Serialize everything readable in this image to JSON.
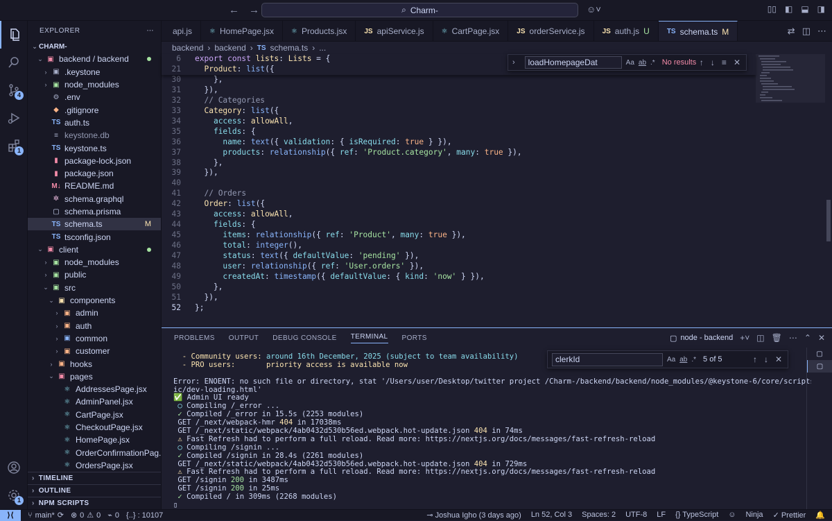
{
  "titlebar": {
    "search": "Charm-"
  },
  "activity": {
    "scm_badge": "4",
    "ext_badge": "1",
    "acct_badge": "1"
  },
  "sidebar": {
    "title": "EXPLORER",
    "root": "CHARM-",
    "items": [
      {
        "label": "backend / backend",
        "depth": 1,
        "kind": "folder-open",
        "icon": "▣",
        "icon_color": "#f38ba8",
        "status": "dot",
        "status_color": "#a6e3a1"
      },
      {
        "label": ".keystone",
        "depth": 2,
        "kind": "folder",
        "icon": "▣",
        "icon_color": "#a6adc8"
      },
      {
        "label": "node_modules",
        "depth": 2,
        "kind": "folder",
        "icon": "▣",
        "icon_color": "#a6e3a1"
      },
      {
        "label": ".env",
        "depth": 2,
        "kind": "file",
        "icon": "⚙",
        "icon_color": "#a6adc8"
      },
      {
        "label": ".gitignore",
        "depth": 2,
        "kind": "file",
        "icon": "◆",
        "icon_color": "#fab387"
      },
      {
        "label": "auth.ts",
        "depth": 2,
        "kind": "file",
        "icon": "TS",
        "icon_color": "#89b4fa"
      },
      {
        "label": "keystone.db",
        "depth": 2,
        "kind": "file",
        "icon": "≡",
        "icon_color": "#a6adc8",
        "muted": true
      },
      {
        "label": "keystone.ts",
        "depth": 2,
        "kind": "file",
        "icon": "TS",
        "icon_color": "#89b4fa"
      },
      {
        "label": "package-lock.json",
        "depth": 2,
        "kind": "file",
        "icon": "▮",
        "icon_color": "#f38ba8"
      },
      {
        "label": "package.json",
        "depth": 2,
        "kind": "file",
        "icon": "▮",
        "icon_color": "#f38ba8"
      },
      {
        "label": "README.md",
        "depth": 2,
        "kind": "file",
        "icon": "M↓",
        "icon_color": "#f38ba8"
      },
      {
        "label": "schema.graphql",
        "depth": 2,
        "kind": "file",
        "icon": "✲",
        "icon_color": "#f5c2e7"
      },
      {
        "label": "schema.prisma",
        "depth": 2,
        "kind": "file",
        "icon": "▢",
        "icon_color": "#cdd6f4"
      },
      {
        "label": "schema.ts",
        "depth": 2,
        "kind": "file",
        "icon": "TS",
        "icon_color": "#89b4fa",
        "selected": true,
        "status": "M",
        "status_color": "#f9e2af"
      },
      {
        "label": "tsconfig.json",
        "depth": 2,
        "kind": "file",
        "icon": "TS",
        "icon_color": "#89b4fa"
      },
      {
        "label": "client",
        "depth": 1,
        "kind": "folder-open",
        "icon": "▣",
        "icon_color": "#f38ba8",
        "status": "dot",
        "status_color": "#a6e3a1"
      },
      {
        "label": "node_modules",
        "depth": 2,
        "kind": "folder",
        "icon": "▣",
        "icon_color": "#a6e3a1"
      },
      {
        "label": "public",
        "depth": 2,
        "kind": "folder",
        "icon": "▣",
        "icon_color": "#a6e3a1"
      },
      {
        "label": "src",
        "depth": 2,
        "kind": "folder-open",
        "icon": "▣",
        "icon_color": "#a6e3a1"
      },
      {
        "label": "components",
        "depth": 3,
        "kind": "folder-open",
        "icon": "▣",
        "icon_color": "#f9e2af"
      },
      {
        "label": "admin",
        "depth": 4,
        "kind": "folder",
        "icon": "▣",
        "icon_color": "#fab387"
      },
      {
        "label": "auth",
        "depth": 4,
        "kind": "folder",
        "icon": "▣",
        "icon_color": "#fab387"
      },
      {
        "label": "common",
        "depth": 4,
        "kind": "folder",
        "icon": "▣",
        "icon_color": "#89b4fa"
      },
      {
        "label": "customer",
        "depth": 4,
        "kind": "folder",
        "icon": "▣",
        "icon_color": "#fab387"
      },
      {
        "label": "hooks",
        "depth": 3,
        "kind": "folder",
        "icon": "▣",
        "icon_color": "#fab387"
      },
      {
        "label": "pages",
        "depth": 3,
        "kind": "folder-open",
        "icon": "▣",
        "icon_color": "#f38ba8"
      },
      {
        "label": "AddressesPage.jsx",
        "depth": 4,
        "kind": "file",
        "icon": "⚛",
        "icon_color": "#89dceb"
      },
      {
        "label": "AdminPanel.jsx",
        "depth": 4,
        "kind": "file",
        "icon": "⚛",
        "icon_color": "#89dceb"
      },
      {
        "label": "CartPage.jsx",
        "depth": 4,
        "kind": "file",
        "icon": "⚛",
        "icon_color": "#89dceb"
      },
      {
        "label": "CheckoutPage.jsx",
        "depth": 4,
        "kind": "file",
        "icon": "⚛",
        "icon_color": "#89dceb"
      },
      {
        "label": "HomePage.jsx",
        "depth": 4,
        "kind": "file",
        "icon": "⚛",
        "icon_color": "#89dceb"
      },
      {
        "label": "OrderConfirmationPag...",
        "depth": 4,
        "kind": "file",
        "icon": "⚛",
        "icon_color": "#89dceb"
      },
      {
        "label": "OrdersPage.jsx",
        "depth": 4,
        "kind": "file",
        "icon": "⚛",
        "icon_color": "#89dceb"
      }
    ],
    "sections": [
      "TIMELINE",
      "OUTLINE",
      "NPM SCRIPTS"
    ]
  },
  "tabs": [
    {
      "label": "api.js",
      "icon": "",
      "icon_color": "#f9e2af"
    },
    {
      "label": "HomePage.jsx",
      "icon": "⚛",
      "icon_color": "#89dceb"
    },
    {
      "label": "Products.jsx",
      "icon": "⚛",
      "icon_color": "#89dceb"
    },
    {
      "label": "apiService.js",
      "icon": "JS",
      "icon_color": "#f9e2af"
    },
    {
      "label": "CartPage.jsx",
      "icon": "⚛",
      "icon_color": "#89dceb"
    },
    {
      "label": "orderService.js",
      "icon": "JS",
      "icon_color": "#f9e2af"
    },
    {
      "label": "auth.js",
      "icon": "JS",
      "icon_color": "#f9e2af",
      "status": "U",
      "status_color": "#a6e3a1"
    },
    {
      "label": "schema.ts",
      "icon": "TS",
      "icon_color": "#89b4fa",
      "status": "M",
      "status_color": "#f9e2af",
      "active": true
    }
  ],
  "breadcrumb": {
    "a": "backend",
    "b": "backend",
    "icon": "TS",
    "file": "schema.ts",
    "more": "..."
  },
  "editor": {
    "sticky": [
      {
        "n": "6",
        "html": "<span class='k'>export const</span> <span class='y'>lists</span>: <span class='y'>Lists</span> = {"
      },
      {
        "n": "21",
        "html": "  <span class='y'>Product</span>: <span class='f'>list</span>({"
      }
    ],
    "lines": [
      {
        "n": "30",
        "html": "    },"
      },
      {
        "n": "31",
        "html": "  }),"
      },
      {
        "n": "32",
        "html": "  <span class='c'>// Categories</span>"
      },
      {
        "n": "33",
        "html": "  <span class='y'>Category</span>: <span class='f'>list</span>({"
      },
      {
        "n": "34",
        "html": "    <span class='p'>access</span>: <span class='y'>allowAll</span>,"
      },
      {
        "n": "35",
        "html": "    <span class='p'>fields</span>: {"
      },
      {
        "n": "36",
        "html": "      <span class='p'>name</span>: <span class='f'>text</span>({ <span class='p'>validation</span>: { <span class='p'>isRequired</span>: <span class='b'>true</span> } }),"
      },
      {
        "n": "37",
        "html": "      <span class='p'>products</span>: <span class='f'>relationship</span>({ <span class='p'>ref</span>: <span class='s'>'Product.category'</span>, <span class='p'>many</span>: <span class='b'>true</span> }),"
      },
      {
        "n": "38",
        "html": "    },"
      },
      {
        "n": "39",
        "html": "  }),"
      },
      {
        "n": "40",
        "html": ""
      },
      {
        "n": "41",
        "html": "  <span class='c'>// Orders</span>"
      },
      {
        "n": "42",
        "html": "  <span class='y'>Order</span>: <span class='f'>list</span>({"
      },
      {
        "n": "43",
        "html": "    <span class='p'>access</span>: <span class='y'>allowAll</span>,"
      },
      {
        "n": "44",
        "html": "    <span class='p'>fields</span>: {"
      },
      {
        "n": "45",
        "html": "      <span class='p'>items</span>: <span class='f'>relationship</span>({ <span class='p'>ref</span>: <span class='s'>'Product'</span>, <span class='p'>many</span>: <span class='b'>true</span> }),"
      },
      {
        "n": "46",
        "html": "      <span class='p'>total</span>: <span class='f'>integer</span>(),"
      },
      {
        "n": "47",
        "html": "      <span class='p'>status</span>: <span class='f'>text</span>({ <span class='p'>defaultValue</span>: <span class='s'>'pending'</span> }),"
      },
      {
        "n": "48",
        "html": "      <span class='p'>user</span>: <span class='f'>relationship</span>({ <span class='p'>ref</span>: <span class='s'>'User.orders'</span> }),"
      },
      {
        "n": "49",
        "html": "      <span class='p'>createdAt</span>: <span class='f'>timestamp</span>({ <span class='p'>defaultValue</span>: { <span class='p'>kind</span>: <span class='s'>'now'</span> } }),"
      },
      {
        "n": "50",
        "html": "    },"
      },
      {
        "n": "51",
        "html": "  }),"
      },
      {
        "n": "52",
        "html": "};",
        "current": true
      }
    ]
  },
  "find": {
    "value": "loadHomepageDat",
    "case": "Aa",
    "word": "ab",
    "regex": ".*",
    "result": "No results"
  },
  "panel": {
    "tabs": [
      "PROBLEMS",
      "OUTPUT",
      "DEBUG CONSOLE",
      "TERMINAL",
      "PORTS"
    ],
    "active_tab": "TERMINAL",
    "terminal_name": "node - backend",
    "find": {
      "value": "clerkId",
      "case": "Aa",
      "word": "ab",
      "regex": ".*",
      "count": "5 of 5"
    },
    "lines": [
      {
        "html": "  <span class='ty'>- Community users: </span><span class='tc'>around 16th December, 2025 (subject to team availability)</span>"
      },
      {
        "html": "  <span class='ty'>- PRO users:       </span><span class='ty'>priority access is available now</span>"
      },
      {
        "html": ""
      },
      {
        "html": "Error: ENOENT: no such file or directory, stat '/Users/user/Desktop/twitter project /Charm-/backend/backend/node_modules/@keystone-6/core/scripts/cli/stat"
      },
      {
        "html": "ic/dev-loading.html'"
      },
      {
        "html": "<span class='tg'>✅</span> Admin UI ready"
      },
      {
        "html": " <span class='tc'>○</span> Compiling /_error ..."
      },
      {
        "html": " <span class='tg'>✓</span> Compiled /_error in 15.5s (2253 modules)"
      },
      {
        "html": " GET /_next/webpack-hmr <span class='ty'>404</span> in 17038ms"
      },
      {
        "html": " GET /_next/static/webpack/4ab0432d530b56ed.webpack.hot-update.json <span class='ty'>404</span> in 74ms"
      },
      {
        "html": " <span class='ty'>⚠</span> Fast Refresh had to perform a full reload. Read more: https://nextjs.org/docs/messages/fast-refresh-reload"
      },
      {
        "html": " <span class='tc'>○</span> Compiling /signin ..."
      },
      {
        "html": " <span class='tg'>✓</span> Compiled /signin in 28.4s (2261 modules)"
      },
      {
        "html": " GET /_next/static/webpack/4ab0432d530b56ed.webpack.hot-update.json <span class='ty'>404</span> in 729ms"
      },
      {
        "html": " <span class='ty'>⚠</span> Fast Refresh had to perform a full reload. Read more: https://nextjs.org/docs/messages/fast-refresh-reload"
      },
      {
        "html": " GET /signin <span class='tg'>200</span> in 3487ms"
      },
      {
        "html": " GET /signin <span class='tg'>200</span> in 25ms"
      },
      {
        "html": " <span class='tg'>✓</span> Compiled / in 309ms (2268 modules)"
      },
      {
        "html": "▯"
      }
    ]
  },
  "status": {
    "branch": "main*",
    "errors": "0",
    "warnings": "0",
    "ports": "0",
    "braces": "{..} : 10107",
    "author": "Joshua Igho (3 days ago)",
    "position": "Ln 52, Col 3",
    "spaces": "Spaces: 2",
    "encoding": "UTF-8",
    "eol": "LF",
    "language": "{} TypeScript",
    "ninja": "Ninja",
    "prettier": "✓ Prettier"
  },
  "colors": {
    "accent": "#89b4fa",
    "bg": "#1e1e2e",
    "surface": "#181825"
  }
}
